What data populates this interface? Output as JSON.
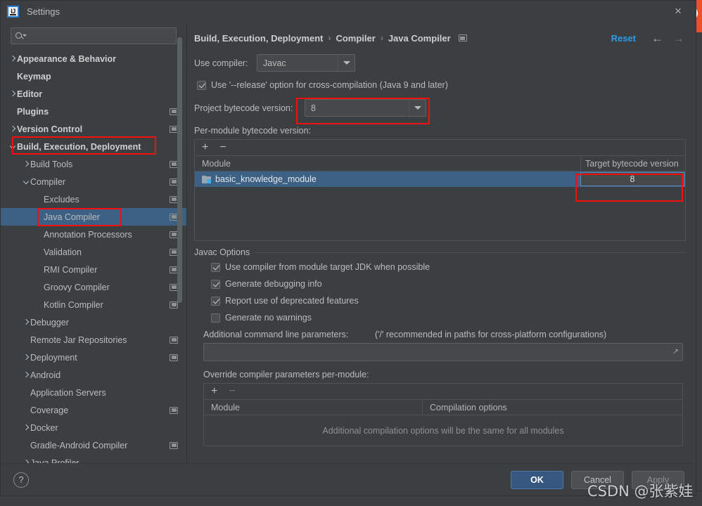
{
  "window": {
    "title": "Settings",
    "app_icon": "intellij-idea-icon",
    "close_label": "×"
  },
  "search": {
    "value": "",
    "placeholder": "",
    "icon": "search-icon"
  },
  "sidebar": {
    "items": [
      {
        "label": "Appearance & Behavior",
        "indent": 0,
        "twisty": "right",
        "bold": true,
        "cfg": false,
        "selected": false
      },
      {
        "label": "Keymap",
        "indent": 0,
        "twisty": "none",
        "bold": true,
        "cfg": false,
        "selected": false
      },
      {
        "label": "Editor",
        "indent": 0,
        "twisty": "right",
        "bold": true,
        "cfg": false,
        "selected": false
      },
      {
        "label": "Plugins",
        "indent": 0,
        "twisty": "none",
        "bold": true,
        "cfg": true,
        "selected": false
      },
      {
        "label": "Version Control",
        "indent": 0,
        "twisty": "right",
        "bold": true,
        "cfg": true,
        "selected": false
      },
      {
        "label": "Build, Execution, Deployment",
        "indent": 0,
        "twisty": "down",
        "bold": true,
        "cfg": false,
        "selected": false
      },
      {
        "label": "Build Tools",
        "indent": 1,
        "twisty": "right",
        "bold": false,
        "cfg": true,
        "selected": false
      },
      {
        "label": "Compiler",
        "indent": 1,
        "twisty": "down",
        "bold": false,
        "cfg": true,
        "selected": false
      },
      {
        "label": "Excludes",
        "indent": 2,
        "twisty": "none",
        "bold": false,
        "cfg": true,
        "selected": false
      },
      {
        "label": "Java Compiler",
        "indent": 2,
        "twisty": "none",
        "bold": false,
        "cfg": true,
        "selected": true
      },
      {
        "label": "Annotation Processors",
        "indent": 2,
        "twisty": "none",
        "bold": false,
        "cfg": true,
        "selected": false
      },
      {
        "label": "Validation",
        "indent": 2,
        "twisty": "none",
        "bold": false,
        "cfg": true,
        "selected": false
      },
      {
        "label": "RMI Compiler",
        "indent": 2,
        "twisty": "none",
        "bold": false,
        "cfg": true,
        "selected": false
      },
      {
        "label": "Groovy Compiler",
        "indent": 2,
        "twisty": "none",
        "bold": false,
        "cfg": true,
        "selected": false
      },
      {
        "label": "Kotlin Compiler",
        "indent": 2,
        "twisty": "none",
        "bold": false,
        "cfg": true,
        "selected": false
      },
      {
        "label": "Debugger",
        "indent": 1,
        "twisty": "right",
        "bold": false,
        "cfg": false,
        "selected": false
      },
      {
        "label": "Remote Jar Repositories",
        "indent": 1,
        "twisty": "none",
        "bold": false,
        "cfg": true,
        "selected": false
      },
      {
        "label": "Deployment",
        "indent": 1,
        "twisty": "right",
        "bold": false,
        "cfg": true,
        "selected": false
      },
      {
        "label": "Android",
        "indent": 1,
        "twisty": "right",
        "bold": false,
        "cfg": false,
        "selected": false
      },
      {
        "label": "Application Servers",
        "indent": 1,
        "twisty": "none",
        "bold": false,
        "cfg": false,
        "selected": false
      },
      {
        "label": "Coverage",
        "indent": 1,
        "twisty": "none",
        "bold": false,
        "cfg": true,
        "selected": false
      },
      {
        "label": "Docker",
        "indent": 1,
        "twisty": "right",
        "bold": false,
        "cfg": false,
        "selected": false
      },
      {
        "label": "Gradle-Android Compiler",
        "indent": 1,
        "twisty": "none",
        "bold": false,
        "cfg": true,
        "selected": false
      },
      {
        "label": "Java Profiler",
        "indent": 1,
        "twisty": "right",
        "bold": false,
        "cfg": false,
        "selected": false
      }
    ]
  },
  "breadcrumb": {
    "items": [
      "Build, Execution, Deployment",
      "Compiler",
      "Java Compiler"
    ],
    "separator": "›",
    "reset_label": "Reset",
    "back_arrow": "←",
    "forward_arrow": "→"
  },
  "main": {
    "use_compiler_label": "Use compiler:",
    "use_compiler_value": "Javac",
    "release_option_label": "Use '--release' option for cross-compilation (Java 9 and later)",
    "release_option_checked": true,
    "project_bytecode_label": "Project bytecode version:",
    "project_bytecode_value": "8",
    "per_module_label": "Per-module bytecode version:",
    "module_table": {
      "add_label": "+",
      "remove_label": "−",
      "columns": [
        "Module",
        "Target bytecode version"
      ],
      "rows": [
        {
          "module": "basic_knowledge_module",
          "target": "8",
          "selected": true
        }
      ]
    },
    "javac_options": {
      "group_title": "Javac Options",
      "checkboxes": [
        {
          "label": "Use compiler from module target JDK when possible",
          "checked": true
        },
        {
          "label": "Generate debugging info",
          "checked": true
        },
        {
          "label": "Report use of deprecated features",
          "checked": true
        },
        {
          "label": "Generate no warnings",
          "checked": false
        }
      ],
      "additional_params_label": "Additional command line parameters:",
      "additional_params_hint": "('/' recommended in paths for cross-platform configurations)",
      "additional_params_value": "",
      "expand_icon": "expand-icon"
    },
    "override_section": {
      "label": "Override compiler parameters per-module:",
      "add_label": "+",
      "remove_label": "−",
      "columns": [
        "Module",
        "Compilation options"
      ],
      "empty_text": "Additional compilation options will be the same for all modules"
    }
  },
  "footer": {
    "help_label": "?",
    "ok_label": "OK",
    "cancel_label": "Cancel",
    "apply_label": "Apply"
  },
  "watermark": {
    "text": "CSDN @张紫娃"
  },
  "colors": {
    "dialog_bg": "#3c3f41",
    "selection_blue": "#3d6185",
    "accent_link": "#2f9ae8",
    "primary_button": "#365880",
    "annotation_red": "#f40f0f",
    "text": "#bbbbbb"
  }
}
